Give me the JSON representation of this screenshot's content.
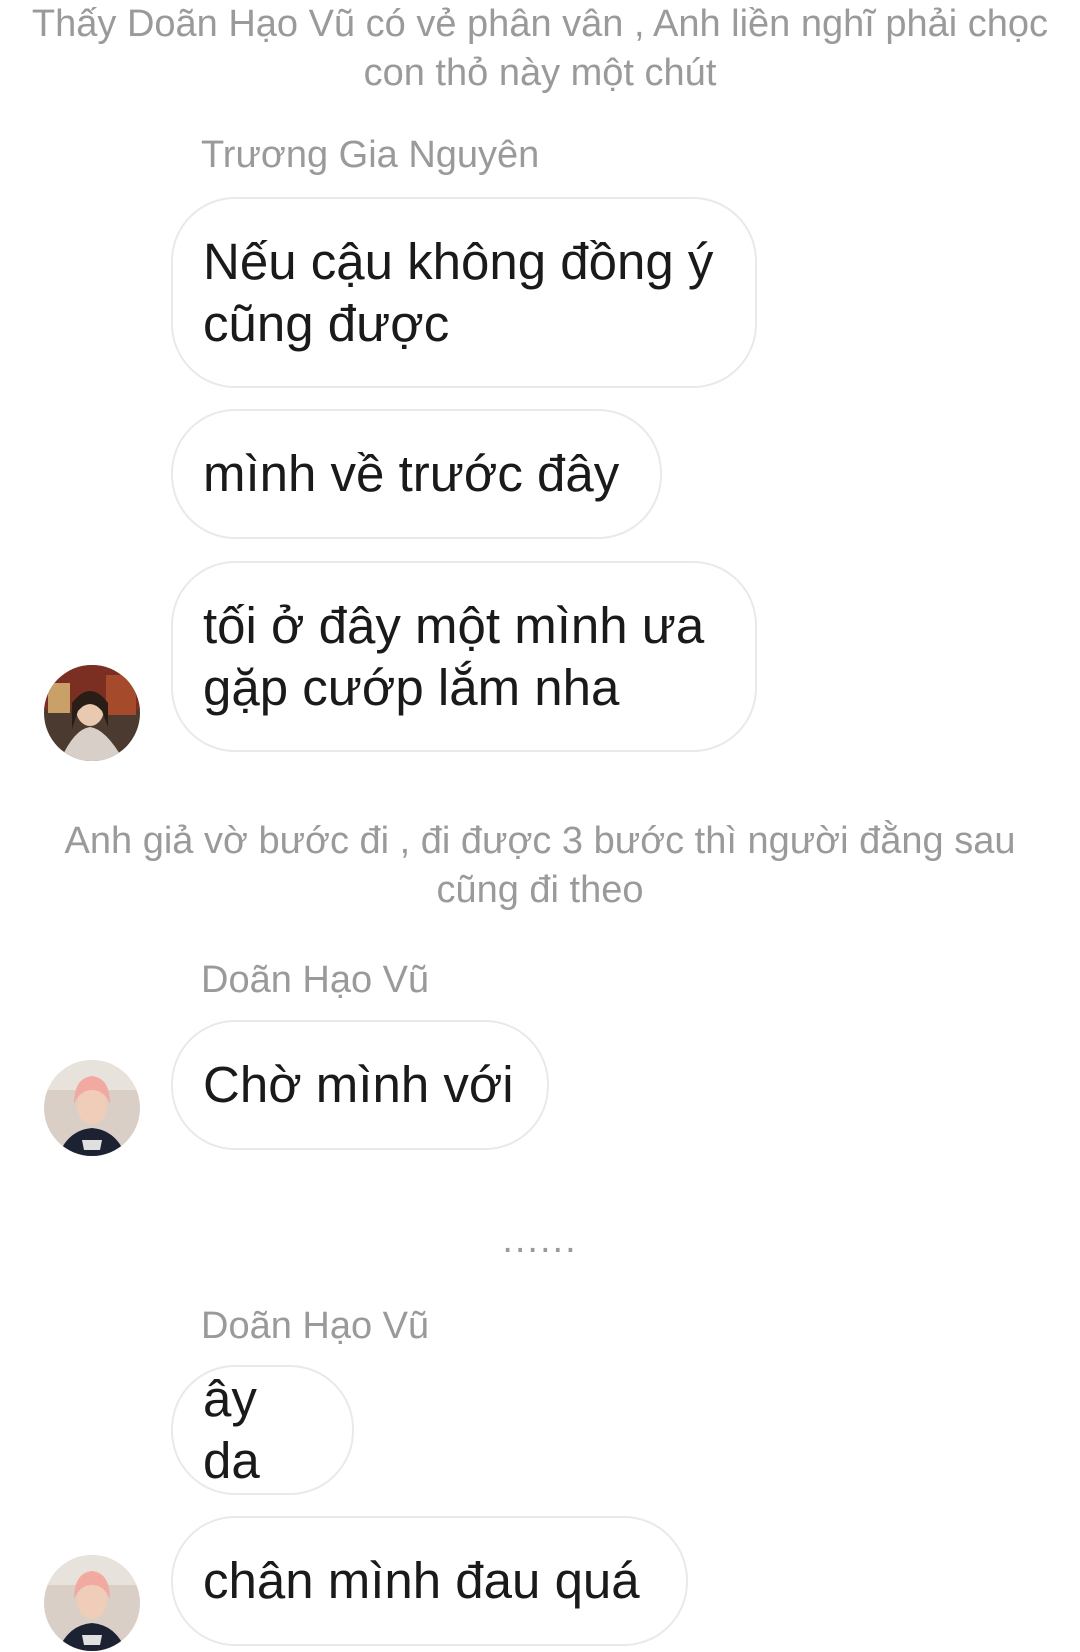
{
  "narration_1": "Thấy Doãn Hạo Vũ có vẻ phân vân , Anh liền nghĩ phải chọc con thỏ này một chút",
  "group_1": {
    "sender": "Trương Gia Nguyên",
    "messages": [
      "Nếu cậu không đồng ý cũng được",
      "mình về trước đây",
      "tối ở đây một mình ưa gặp cướp lắm nha"
    ]
  },
  "narration_2": "Anh giả vờ bước đi  , đi được 3 bước thì người đằng sau cũng đi theo",
  "group_2": {
    "sender": "Doãn Hạo Vũ",
    "messages": [
      "Chờ mình với"
    ]
  },
  "ellipsis": "......",
  "group_3": {
    "sender": "Doãn Hạo Vũ",
    "messages": [
      "ây da",
      "chân mình đau quá"
    ]
  },
  "colors": {
    "background": "#ffffff",
    "bubble_border": "#e9e9e9",
    "message_text": "#1a1a1a",
    "meta_text": "#9a9a9a"
  }
}
